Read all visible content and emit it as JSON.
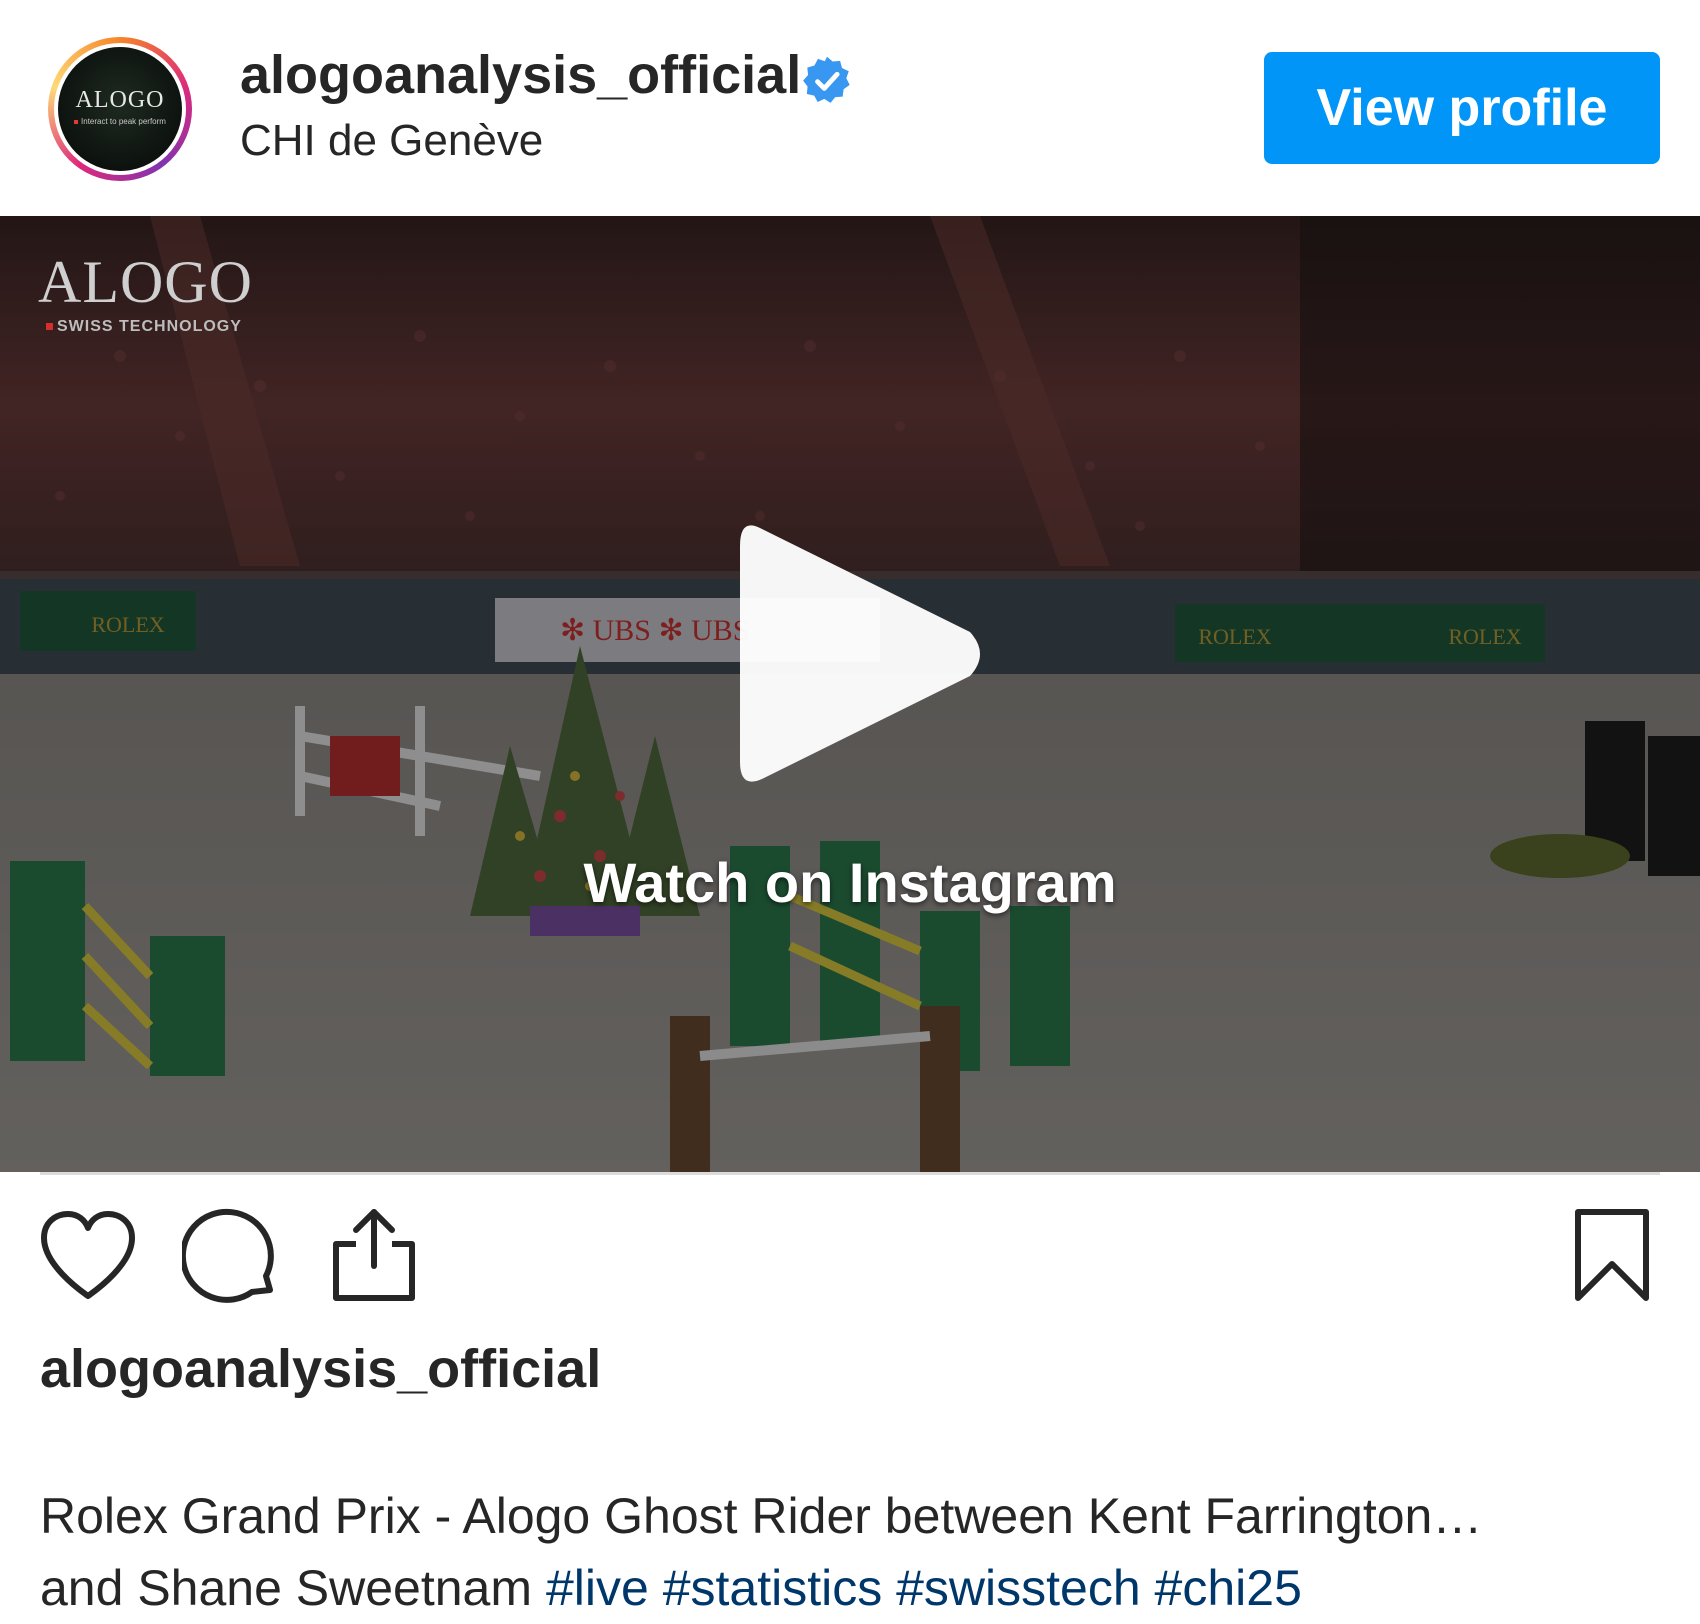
{
  "header": {
    "username": "alogoanalysis_official",
    "location": "CHI de Genève",
    "view_profile_label": "View profile",
    "avatar_logo_text": "ALOGO",
    "avatar_logo_sub": "Interact to peak perform"
  },
  "media": {
    "brand_logo_word": "ALOGO",
    "brand_logo_tag": "SWISS TECHNOLOGY",
    "watch_label": "Watch on Instagram",
    "type": "video"
  },
  "actions": {
    "icons": [
      "heart-icon",
      "comment-icon",
      "share-icon",
      "bookmark-icon"
    ]
  },
  "caption": {
    "username": "alogoanalysis_official",
    "line1": "Rolex Grand Prix - Alogo Ghost Rider between Kent Farrington…",
    "line2_text": "and Shane Sweetnam",
    "hashtags": [
      "#live",
      "#statistics",
      "#swisstech",
      "#chi25"
    ]
  },
  "colors": {
    "button_blue": "#0095f6",
    "hashtag_blue": "#00376b",
    "verified_blue": "#3897f0",
    "text_dark": "#262626"
  }
}
